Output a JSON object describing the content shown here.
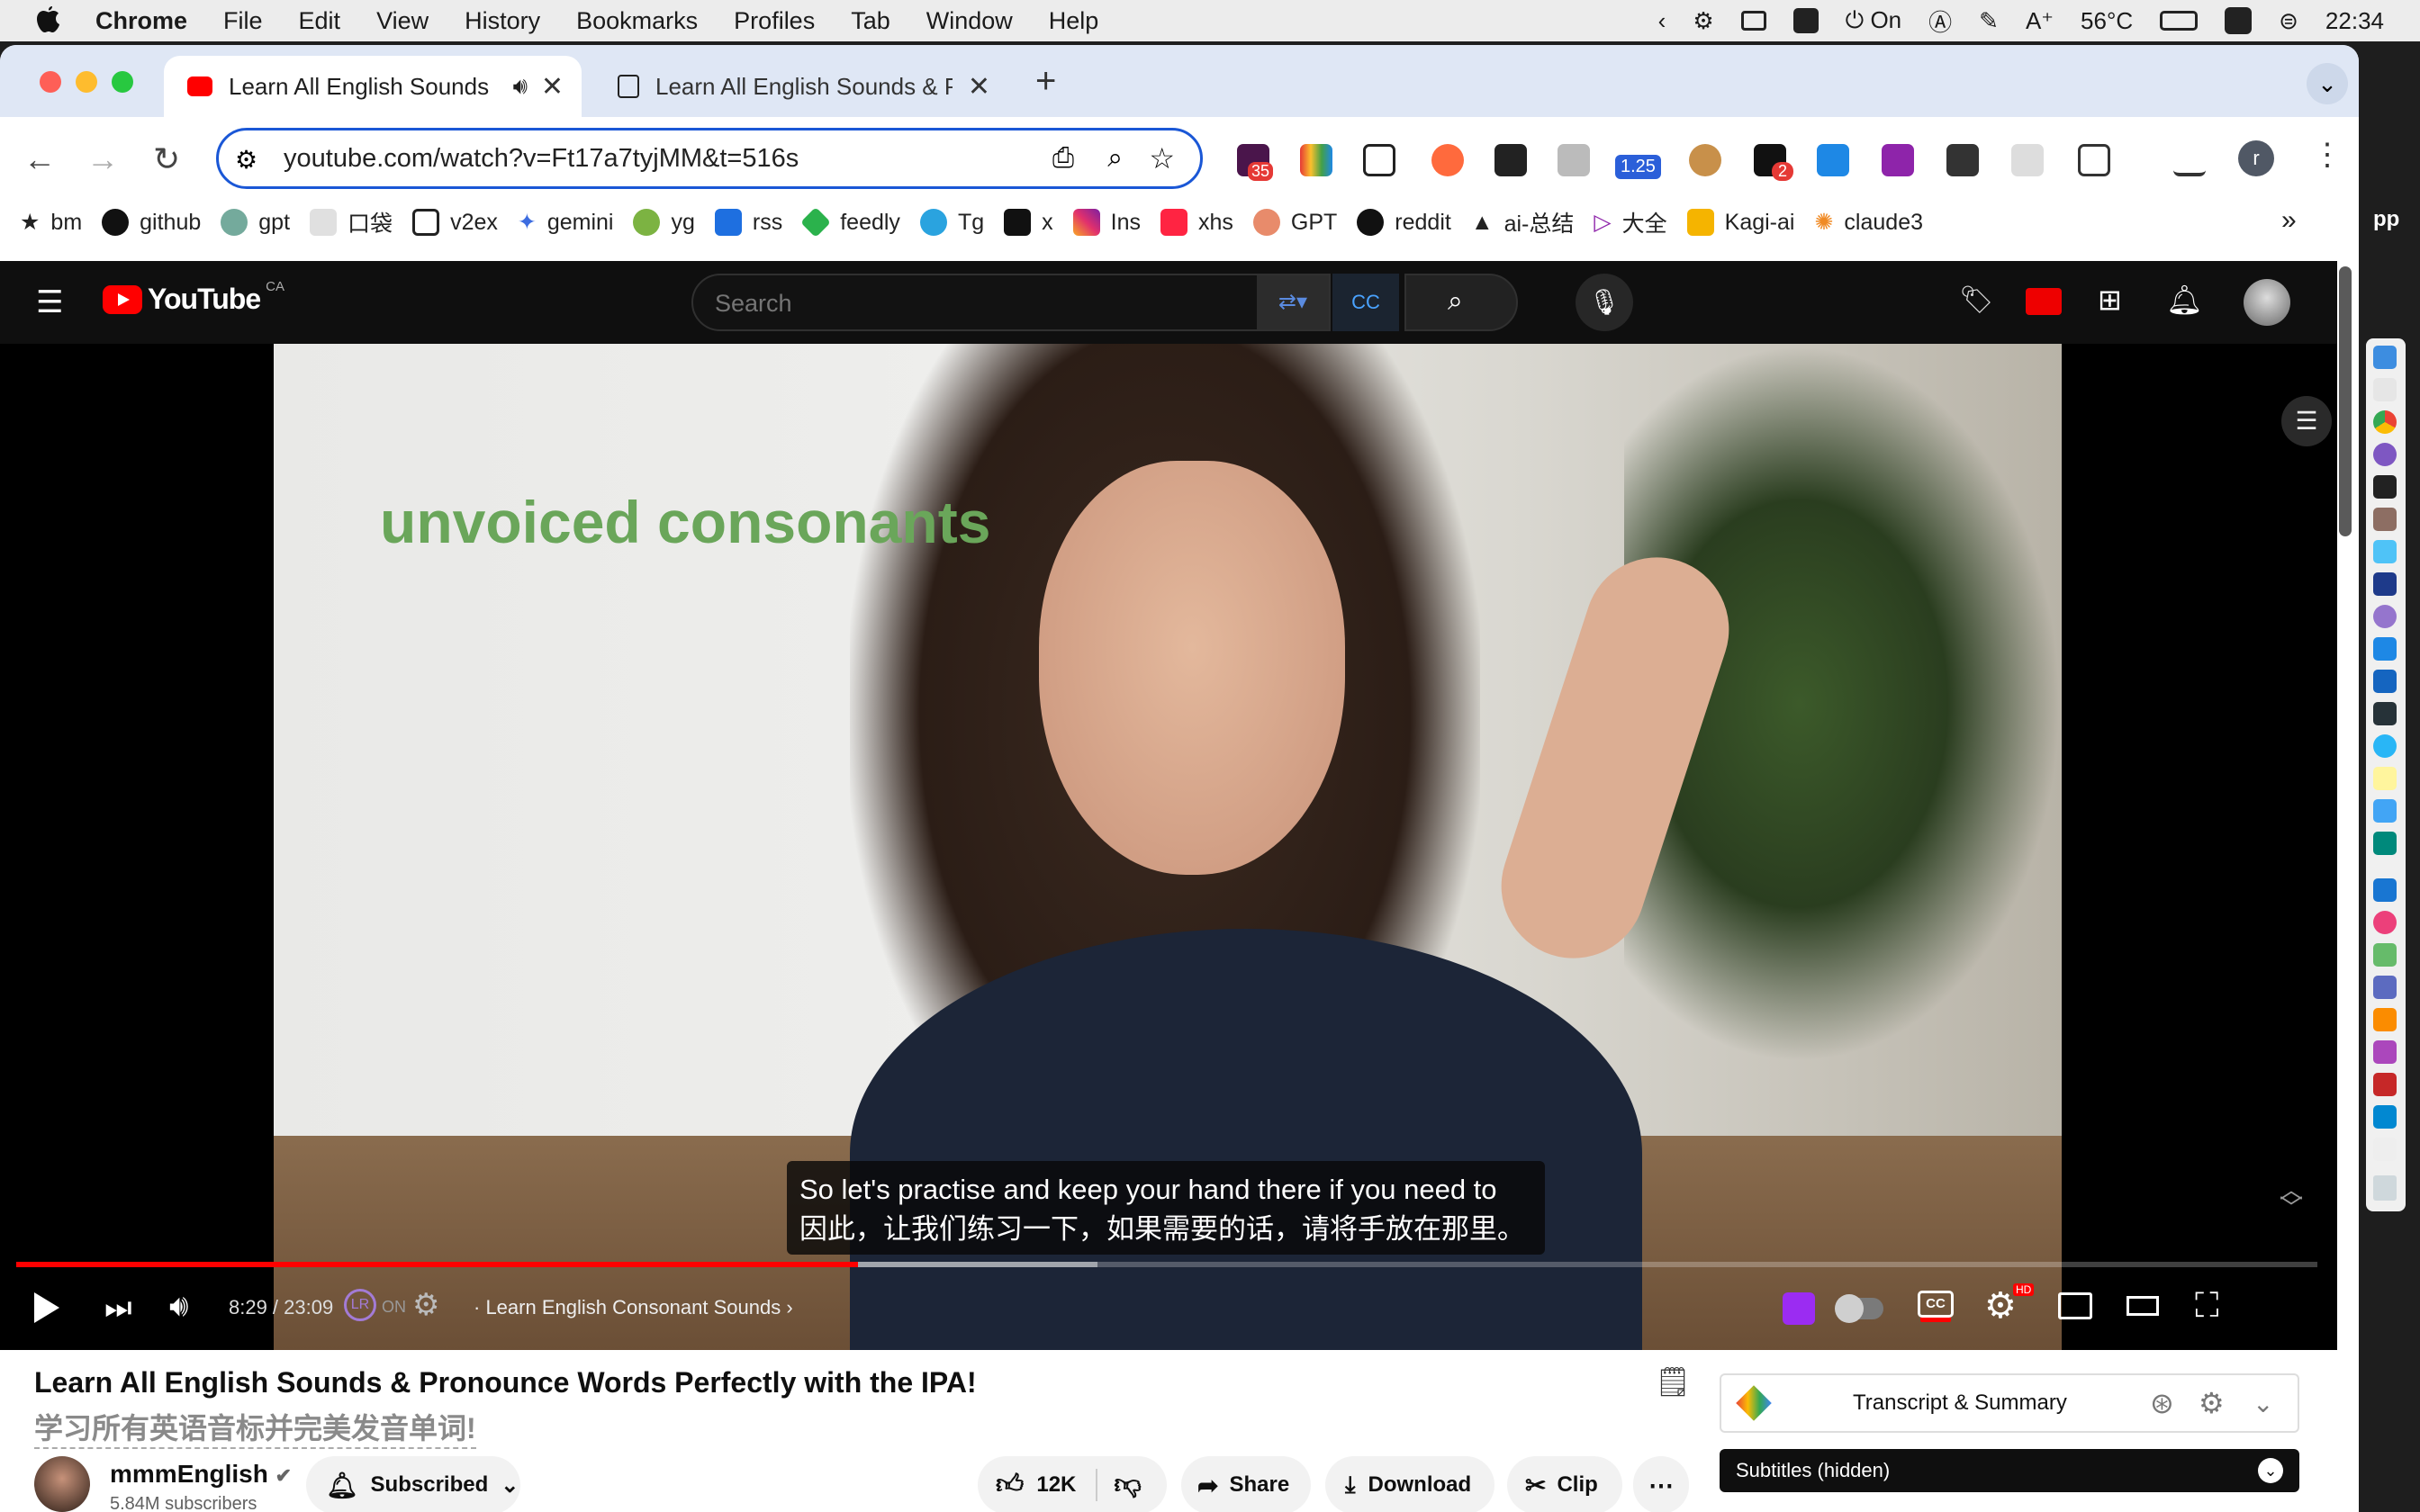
{
  "menubar": {
    "app": "Chrome",
    "items": [
      "File",
      "Edit",
      "View",
      "History",
      "Bookmarks",
      "Profiles",
      "Tab",
      "Window",
      "Help"
    ],
    "status_on": "On",
    "temperature": "56°C",
    "clock": "22:34"
  },
  "tabs": [
    {
      "title": "Learn All English Sounds",
      "active": true
    },
    {
      "title": "Learn All English Sounds & P",
      "active": false
    }
  ],
  "toolbar": {
    "url": "youtube.com/watch?v=Ft17a7tyjMM&t=516s",
    "ext_badges": [
      "35",
      "1.25",
      "2"
    ],
    "profile_initial": "r"
  },
  "bookmarks": [
    "bm",
    "github",
    "gpt",
    "口袋",
    "v2ex",
    "gemini",
    "yg",
    "rss",
    "feedly",
    "Tg",
    "x",
    "Ins",
    "xhs",
    "GPT",
    "reddit",
    "ai-总结",
    "大全",
    "Kagi-ai",
    "claude3"
  ],
  "youtube": {
    "logo": "YouTube",
    "region": "CA",
    "search_placeholder": "Search",
    "video_overlay_text": "unvoiced consonants",
    "caption_en": "So let's practise and keep your hand there if you need to",
    "caption_zh": "因此，让我们练习一下，如果需要的话，请将手放在那里。",
    "time": "8:29 / 23:09",
    "on_label": "ON",
    "chapter": "· Learn English Consonant Sounds",
    "progress": 0.366,
    "buffered": 0.47,
    "title": "Learn All English Sounds & Pronounce Words Perfectly with the IPA!",
    "title_zh": "学习所有英语音标并完美发音单词!",
    "channel": "mmmEnglish",
    "subscribers": "5.84M subscribers",
    "subscribed_label": "Subscribed",
    "likes": "12K",
    "share": "Share",
    "download": "Download",
    "clip": "Clip",
    "transcript_label": "Transcript & Summary",
    "subtitles_label": "Subtitles (hidden)",
    "sidebar_peek": "pp"
  },
  "colors": {
    "yt_red": "#ff0000",
    "omnibox_focus": "#1a57d6",
    "tabstrip": "#dfe7f5"
  }
}
